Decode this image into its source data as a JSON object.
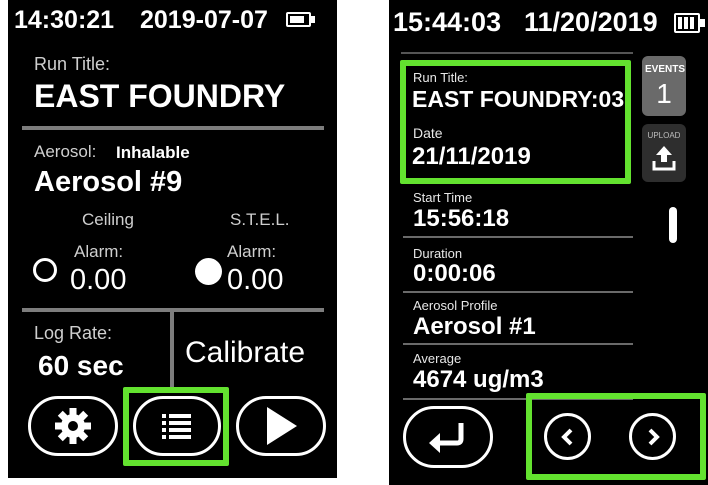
{
  "left": {
    "status_time": "14:30:21",
    "status_date": "2019-07-07",
    "battery_icon": "battery-icon",
    "run_title_label": "Run Title:",
    "run_title_value": "EAST FOUNDRY",
    "aerosol_label": "Aerosol:",
    "aerosol_type": "Inhalable",
    "aerosol_value": "Aerosol #9",
    "ceiling_label": "Ceiling",
    "ceiling_alarm_label": "Alarm:",
    "ceiling_alarm_value": "0.00",
    "stel_label": "S.T.E.L.",
    "stel_alarm_label": "Alarm:",
    "stel_alarm_value": "0.00",
    "log_rate_label": "Log Rate:",
    "log_rate_value": "60 sec",
    "calibrate_label": "Calibrate",
    "buttons": {
      "settings": "gear-icon",
      "list": "list-icon",
      "play": "play-icon"
    }
  },
  "right": {
    "status_time": "15:44:03",
    "status_date": "11/20/2019",
    "events_label": "EVENTS",
    "events_count": "1",
    "upload_label": "UPLOAD",
    "run_title_label": "Run Title:",
    "run_title_value": "EAST FOUNDRY:03",
    "date_label": "Date",
    "date_value": "21/11/2019",
    "start_time_label": "Start Time",
    "start_time_value": "15:56:18",
    "duration_label": "Duration",
    "duration_value": "0:00:06",
    "aerosol_profile_label": "Aerosol Profile",
    "aerosol_profile_value": "Aerosol #1",
    "average_label": "Average",
    "average_value": "4674 ug/m3",
    "buttons": {
      "back": "return-icon",
      "prev": "chevron-left-icon",
      "next": "chevron-right-icon"
    }
  },
  "colors": {
    "highlight": "#63e22f",
    "screen": "#000000"
  }
}
